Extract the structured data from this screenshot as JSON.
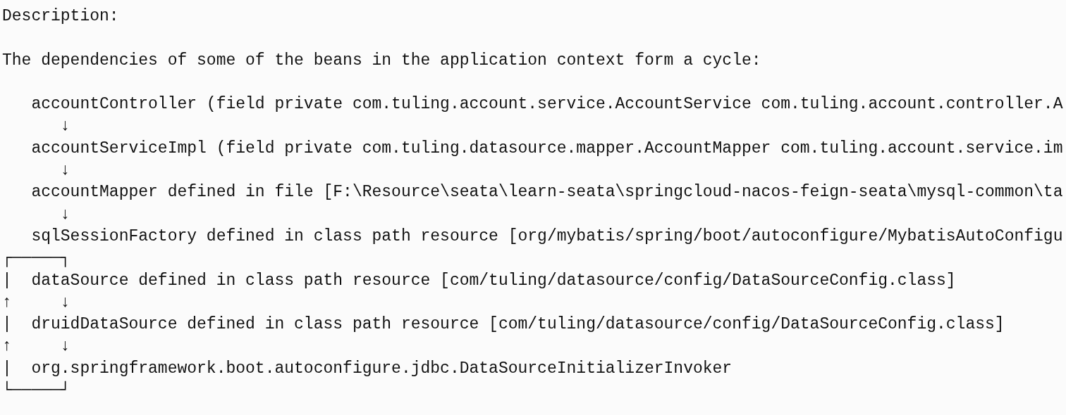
{
  "description_label": "Description:",
  "message": "The dependencies of some of the beans in the application context form a cycle:",
  "dependency_chain": [
    "   accountController (field private com.tuling.account.service.AccountService com.tuling.account.controller.A",
    "      ↓",
    "   accountServiceImpl (field private com.tuling.datasource.mapper.AccountMapper com.tuling.account.service.im",
    "      ↓",
    "   accountMapper defined in file [F:\\Resource\\seata\\learn-seata\\springcloud-nacos-feign-seata\\mysql-common\\ta",
    "      ↓",
    "   sqlSessionFactory defined in class path resource [org/mybatis/spring/boot/autoconfigure/MybatisAutoConfigu",
    "┌─────┐",
    "|  dataSource defined in class path resource [com/tuling/datasource/config/DataSourceConfig.class]",
    "↑     ↓",
    "|  druidDataSource defined in class path resource [com/tuling/datasource/config/DataSourceConfig.class]",
    "↑     ↓",
    "|  org.springframework.boot.autoconfigure.jdbc.DataSourceInitializerInvoker",
    "└─────┘"
  ]
}
